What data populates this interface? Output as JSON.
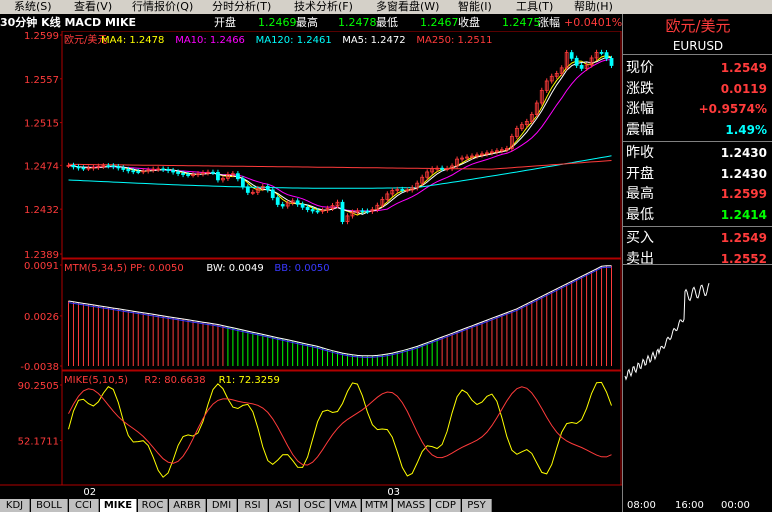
{
  "menu": {
    "items": [
      "系统(S)",
      "查看(V)",
      "行情报价(Q)",
      "分时分析(T)",
      "技术分析(F)",
      "多窗看盘(W)",
      "智能(I)",
      "工具(T)",
      "帮助(H)"
    ]
  },
  "header": {
    "title": "30分钟 K线 MACD MIKE",
    "open_label": "开盘",
    "open_value": "1.2469",
    "high_label": "最高",
    "high_value": "1.2478",
    "low_label": "最低",
    "low_value": "1.2467",
    "close_label": "收盘",
    "close_value": "1.2475",
    "change_label": "涨幅",
    "change_value": "+0.0401%"
  },
  "main_chart": {
    "legend": [
      {
        "text": "欧元/美元",
        "color": "#ff3b3b"
      },
      {
        "text": "MA4: 1.2478",
        "color": "#ffff00"
      },
      {
        "text": "MA10: 1.2466",
        "color": "#ff00ff"
      },
      {
        "text": "MA120: 1.2461",
        "color": "#00ffff"
      },
      {
        "text": "MA5: 1.2472",
        "color": "#ffffff"
      },
      {
        "text": "MA250: 1.2511",
        "color": "#ff3b3b"
      }
    ],
    "y_ticks": [
      "1.2599",
      "1.2557",
      "1.2515",
      "1.2474",
      "1.2432",
      "1.2389"
    ]
  },
  "mtm_chart": {
    "legend": [
      {
        "text": "MTM(5,34,5) PP: 0.0050",
        "color": "#ff3b3b"
      },
      {
        "text": "BW: 0.0049",
        "color": "#ffffff"
      },
      {
        "text": "BB: 0.0050",
        "color": "#3a3aff"
      }
    ],
    "y_ticks": [
      "0.0091",
      "0.0026",
      "-0.0038"
    ]
  },
  "mike_chart": {
    "legend": [
      {
        "text": "MIKE(5,10,5)",
        "color": "#ff3b3b"
      },
      {
        "text": "R2: 80.6638",
        "color": "#ff3b3b"
      },
      {
        "text": "R1: 72.3259",
        "color": "#ffff00"
      }
    ],
    "y_ticks": [
      "90.2505",
      "52.1711"
    ]
  },
  "x_labels": [
    "02",
    "03"
  ],
  "tabs": [
    "KDJ",
    "BOLL",
    "CCI",
    "MIKE",
    "ROC",
    "ARBR",
    "DMI",
    "RSI",
    "ASI",
    "OSC",
    "VMA",
    "MTM",
    "MASS",
    "CDP",
    "PSY"
  ],
  "active_tab": "MIKE",
  "quote": {
    "title": "欧元/美元",
    "code": "EURUSD",
    "rows": [
      {
        "label": "现价",
        "value": "1.2549",
        "color": "#ff3b3b"
      },
      {
        "label": "涨跌",
        "value": "0.0119",
        "color": "#ff3b3b"
      },
      {
        "label": "涨幅",
        "value": "+0.9574%",
        "color": "#ff3b3b"
      },
      {
        "label": "震幅",
        "value": "1.49%",
        "color": "#00ffff"
      },
      {
        "label": "昨收",
        "value": "1.2430",
        "color": "#ffffff"
      },
      {
        "label": "开盘",
        "value": "1.2430",
        "color": "#ffffff"
      },
      {
        "label": "最高",
        "value": "1.2599",
        "color": "#ff3b3b"
      },
      {
        "label": "最低",
        "value": "1.2414",
        "color": "#00ff00"
      },
      {
        "label": "买入",
        "value": "1.2549",
        "color": "#ff3b3b"
      },
      {
        "label": "卖出",
        "value": "1.2552",
        "color": "#ff3b3b"
      }
    ],
    "times": [
      "08:00",
      "16:00",
      "00:00"
    ]
  },
  "colors": {
    "up": "#ff3b3b",
    "down": "#00ffff",
    "ma4": "#ffff00",
    "ma10": "#ff00ff",
    "ma120": "#00ffff",
    "ma5": "#ffffff",
    "ma250": "#ff3b3b"
  }
}
